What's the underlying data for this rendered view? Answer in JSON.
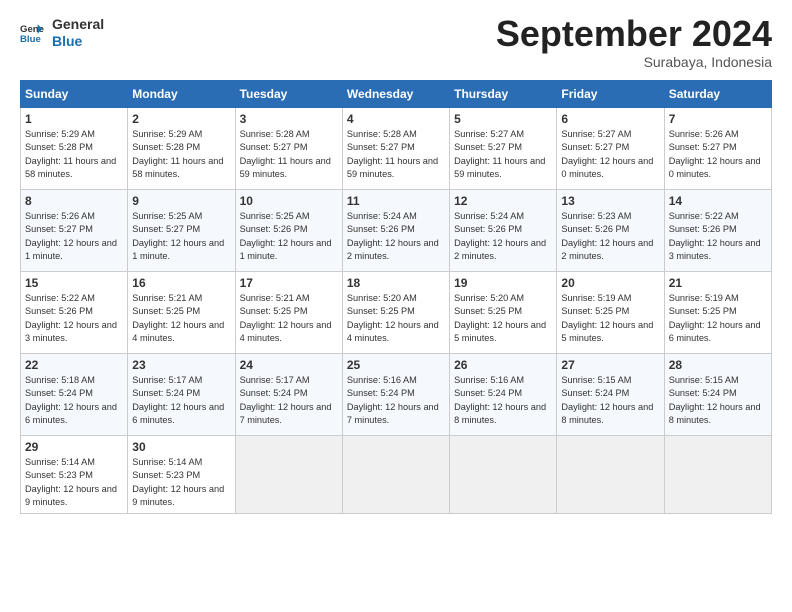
{
  "header": {
    "logo_line1": "General",
    "logo_line2": "Blue",
    "month": "September 2024",
    "location": "Surabaya, Indonesia"
  },
  "days_of_week": [
    "Sunday",
    "Monday",
    "Tuesday",
    "Wednesday",
    "Thursday",
    "Friday",
    "Saturday"
  ],
  "weeks": [
    [
      {
        "num": "1",
        "rise": "5:29 AM",
        "set": "5:28 PM",
        "daylight": "11 hours and 58 minutes."
      },
      {
        "num": "2",
        "rise": "5:29 AM",
        "set": "5:28 PM",
        "daylight": "11 hours and 58 minutes."
      },
      {
        "num": "3",
        "rise": "5:28 AM",
        "set": "5:27 PM",
        "daylight": "11 hours and 59 minutes."
      },
      {
        "num": "4",
        "rise": "5:28 AM",
        "set": "5:27 PM",
        "daylight": "11 hours and 59 minutes."
      },
      {
        "num": "5",
        "rise": "5:27 AM",
        "set": "5:27 PM",
        "daylight": "11 hours and 59 minutes."
      },
      {
        "num": "6",
        "rise": "5:27 AM",
        "set": "5:27 PM",
        "daylight": "12 hours and 0 minutes."
      },
      {
        "num": "7",
        "rise": "5:26 AM",
        "set": "5:27 PM",
        "daylight": "12 hours and 0 minutes."
      }
    ],
    [
      {
        "num": "8",
        "rise": "5:26 AM",
        "set": "5:27 PM",
        "daylight": "12 hours and 1 minute."
      },
      {
        "num": "9",
        "rise": "5:25 AM",
        "set": "5:27 PM",
        "daylight": "12 hours and 1 minute."
      },
      {
        "num": "10",
        "rise": "5:25 AM",
        "set": "5:26 PM",
        "daylight": "12 hours and 1 minute."
      },
      {
        "num": "11",
        "rise": "5:24 AM",
        "set": "5:26 PM",
        "daylight": "12 hours and 2 minutes."
      },
      {
        "num": "12",
        "rise": "5:24 AM",
        "set": "5:26 PM",
        "daylight": "12 hours and 2 minutes."
      },
      {
        "num": "13",
        "rise": "5:23 AM",
        "set": "5:26 PM",
        "daylight": "12 hours and 2 minutes."
      },
      {
        "num": "14",
        "rise": "5:22 AM",
        "set": "5:26 PM",
        "daylight": "12 hours and 3 minutes."
      }
    ],
    [
      {
        "num": "15",
        "rise": "5:22 AM",
        "set": "5:26 PM",
        "daylight": "12 hours and 3 minutes."
      },
      {
        "num": "16",
        "rise": "5:21 AM",
        "set": "5:25 PM",
        "daylight": "12 hours and 4 minutes."
      },
      {
        "num": "17",
        "rise": "5:21 AM",
        "set": "5:25 PM",
        "daylight": "12 hours and 4 minutes."
      },
      {
        "num": "18",
        "rise": "5:20 AM",
        "set": "5:25 PM",
        "daylight": "12 hours and 4 minutes."
      },
      {
        "num": "19",
        "rise": "5:20 AM",
        "set": "5:25 PM",
        "daylight": "12 hours and 5 minutes."
      },
      {
        "num": "20",
        "rise": "5:19 AM",
        "set": "5:25 PM",
        "daylight": "12 hours and 5 minutes."
      },
      {
        "num": "21",
        "rise": "5:19 AM",
        "set": "5:25 PM",
        "daylight": "12 hours and 6 minutes."
      }
    ],
    [
      {
        "num": "22",
        "rise": "5:18 AM",
        "set": "5:24 PM",
        "daylight": "12 hours and 6 minutes."
      },
      {
        "num": "23",
        "rise": "5:17 AM",
        "set": "5:24 PM",
        "daylight": "12 hours and 6 minutes."
      },
      {
        "num": "24",
        "rise": "5:17 AM",
        "set": "5:24 PM",
        "daylight": "12 hours and 7 minutes."
      },
      {
        "num": "25",
        "rise": "5:16 AM",
        "set": "5:24 PM",
        "daylight": "12 hours and 7 minutes."
      },
      {
        "num": "26",
        "rise": "5:16 AM",
        "set": "5:24 PM",
        "daylight": "12 hours and 8 minutes."
      },
      {
        "num": "27",
        "rise": "5:15 AM",
        "set": "5:24 PM",
        "daylight": "12 hours and 8 minutes."
      },
      {
        "num": "28",
        "rise": "5:15 AM",
        "set": "5:24 PM",
        "daylight": "12 hours and 8 minutes."
      }
    ],
    [
      {
        "num": "29",
        "rise": "5:14 AM",
        "set": "5:23 PM",
        "daylight": "12 hours and 9 minutes."
      },
      {
        "num": "30",
        "rise": "5:14 AM",
        "set": "5:23 PM",
        "daylight": "12 hours and 9 minutes."
      },
      null,
      null,
      null,
      null,
      null
    ]
  ]
}
